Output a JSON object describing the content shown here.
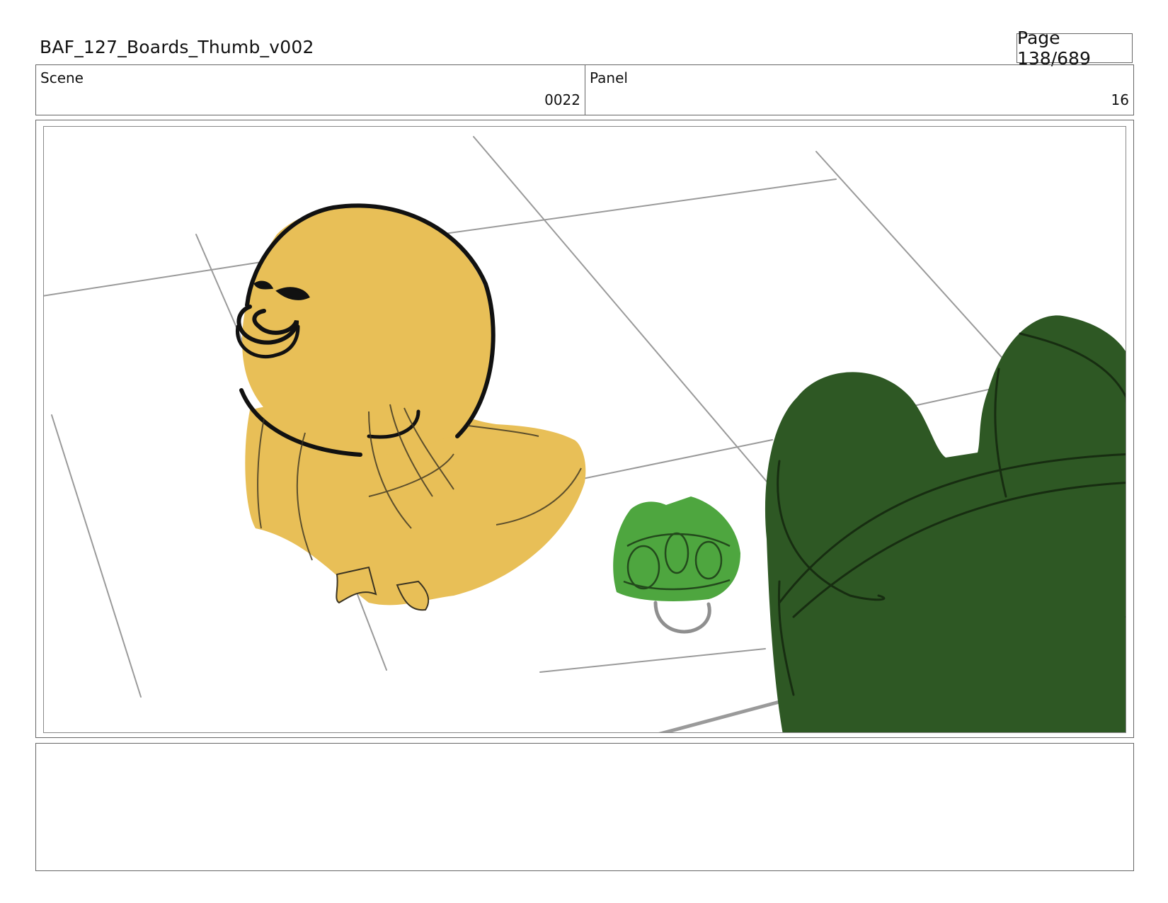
{
  "header": {
    "doc_title": "BAF_127_Boards_Thumb_v002",
    "page_label": "Page 138/689"
  },
  "info": {
    "scene_label": "Scene",
    "scene_value": "0022",
    "panel_label": "Panel",
    "panel_value": "16"
  },
  "artwork": {
    "colors": {
      "duck_fill": "#E8BF57",
      "frog_dark": "#2E5824",
      "frog_small": "#3F9E2F",
      "line": "#111111",
      "floor_lines": "#9A9A9A"
    }
  },
  "notes": {
    "text": ""
  }
}
